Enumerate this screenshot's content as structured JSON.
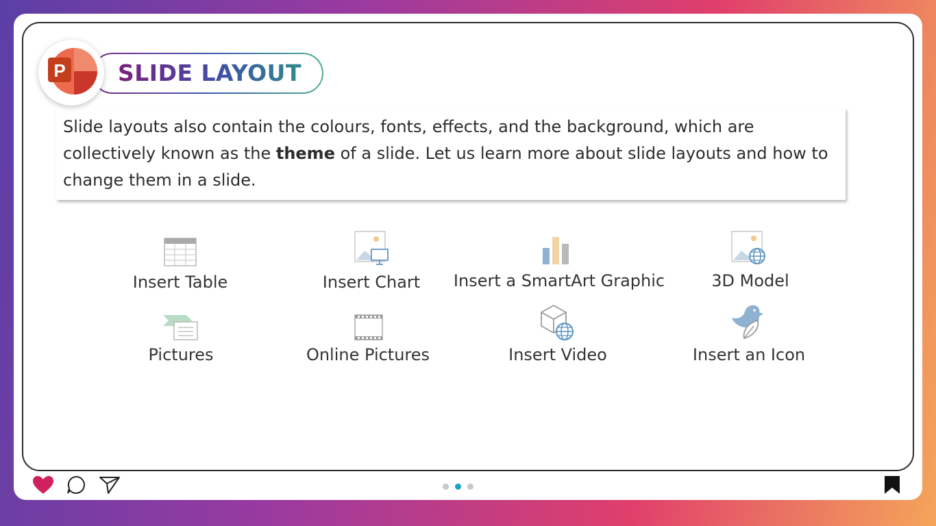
{
  "slide": {
    "title": "SLIDE LAYOUT",
    "logo_letter": "P",
    "paragraph": {
      "part1": "Slide layouts also contain the colours, fonts, effects, and the background, which are collectively known as the ",
      "bold": "theme",
      "part2": " of a slide. Let us learn more about slide layouts and how to change them in a slide."
    }
  },
  "layout_options": [
    {
      "label": "Insert Table",
      "icon": "table-icon"
    },
    {
      "label": "Insert Chart",
      "icon": "chart-icon"
    },
    {
      "label": "Insert a SmartArt Graphic",
      "icon": "smartart-icon"
    },
    {
      "label": "3D Model",
      "icon": "3d-model-icon"
    },
    {
      "label": "Pictures",
      "icon": "pictures-icon"
    },
    {
      "label": "Online Pictures",
      "icon": "online-pictures-icon"
    },
    {
      "label": "Insert Video",
      "icon": "video-icon"
    },
    {
      "label": "Insert an Icon",
      "icon": "icon-icon"
    }
  ],
  "footer": {
    "icons": [
      "heart-icon",
      "comment-icon",
      "send-icon",
      "bookmark-icon"
    ],
    "pagination": {
      "total": 3,
      "active": 2
    },
    "colors": {
      "heart": "#d0215f",
      "dot_active": "#1aa3c2",
      "dot_inactive": "#c8c8c8"
    }
  }
}
